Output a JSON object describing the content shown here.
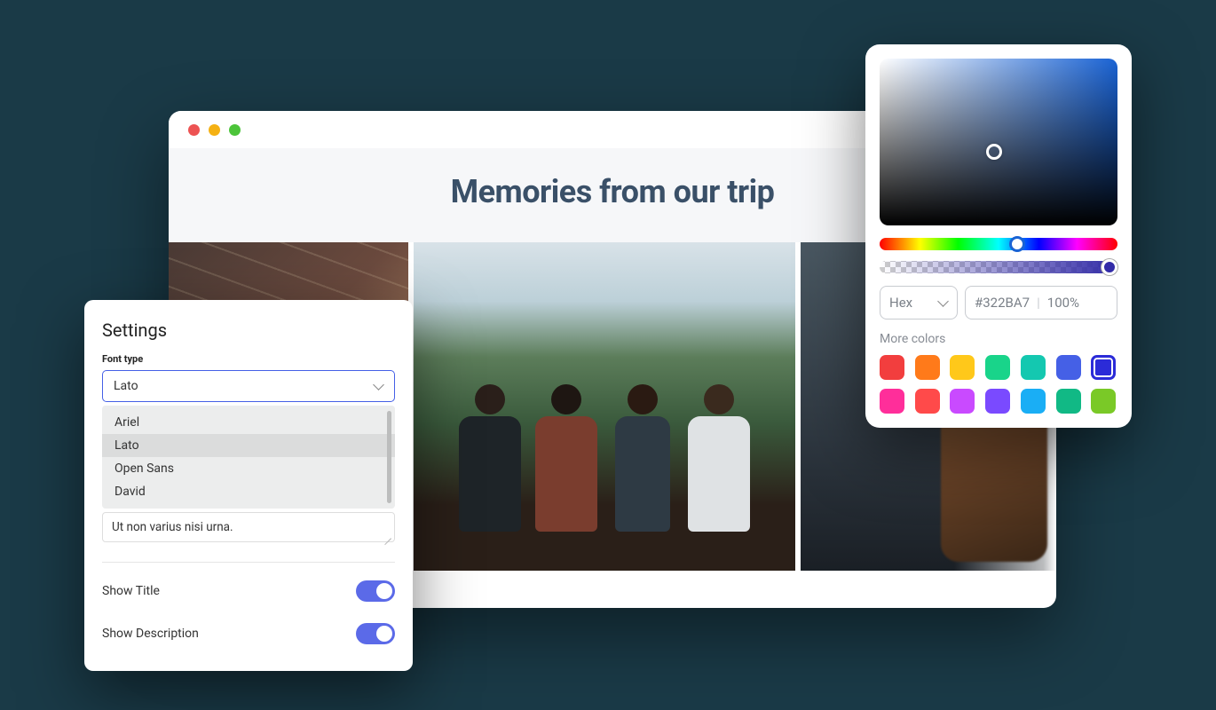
{
  "browser": {
    "title": "Memories from our trip"
  },
  "settings": {
    "title": "Settings",
    "font_type_label": "Font type",
    "font_selected": "Lato",
    "font_options": [
      "Ariel",
      "Lato",
      "Open Sans",
      "David"
    ],
    "description_value": "Ut non varius nisi urna.",
    "toggles": {
      "show_title": {
        "label": "Show Title",
        "on": true
      },
      "show_description": {
        "label": "Show Description",
        "on": true
      }
    }
  },
  "color_picker": {
    "mode": "Hex",
    "hex": "#322BA7",
    "opacity": "100%",
    "more_label": "More colors",
    "swatches_row1": [
      "#f23e3e",
      "#ff7a1a",
      "#ffc81a",
      "#19d48a",
      "#14c8b0",
      "#4560e6",
      "#2b2bd8"
    ],
    "swatches_row2": [
      "#ff2e9a",
      "#ff4a4a",
      "#c94aff",
      "#7a4aff",
      "#1aaef5",
      "#11b985",
      "#7ac927"
    ],
    "selected_swatch": "#2b2bd8"
  }
}
